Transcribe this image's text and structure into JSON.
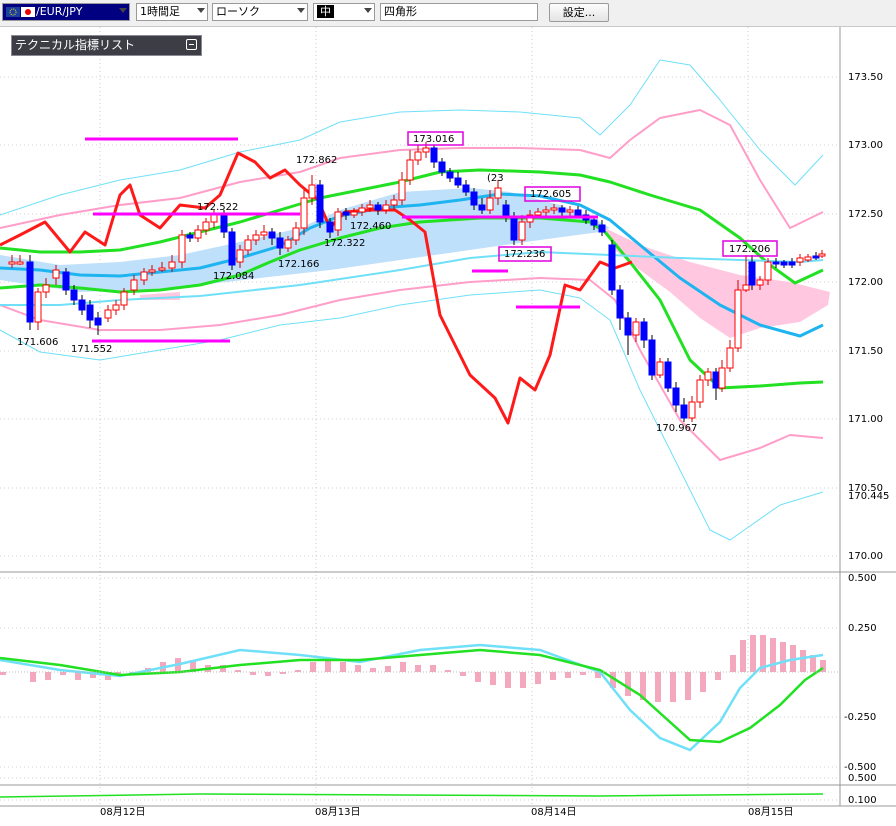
{
  "toolbar": {
    "symbol": "/EUR/JPY",
    "timeframe": "1時間足",
    "chart_type": "ローソク",
    "line_style": "中",
    "drawing_tool": "四角形",
    "settings_label": "設定..."
  },
  "indicator_panel": {
    "title": "テクニカル指標リスト"
  },
  "price_axis": {
    "labels": [
      "173.50",
      "173.00",
      "172.50",
      "172.00",
      "171.50",
      "171.00",
      "170.50",
      "170.00"
    ],
    "current_price": "170.445"
  },
  "macd_axis": {
    "labels": [
      "0.500",
      "0.250",
      "-0.250",
      "-0.500"
    ]
  },
  "sub_axis": {
    "labels": [
      "0.500",
      "0.100"
    ]
  },
  "time_axis": {
    "labels": [
      "08月12日",
      "08月13日",
      "08月14日",
      "08月15日"
    ]
  },
  "annotations": {
    "high_1": "172.862",
    "high_2": "172.522",
    "low_1": "172.084",
    "low_2": "172.166",
    "low_3": "172.322",
    "mid_1": "172.460",
    "low_left_1": "171.606",
    "low_left_2": "171.552",
    "box_high": "173.016",
    "box_mid_high": "172.605",
    "box_mid_low": "172.236",
    "small_label": "(23",
    "box_right": "172.206",
    "low_main": "170.967"
  },
  "colors": {
    "bull": "#ff0000",
    "bear": "#0000ff",
    "ma_red": "#ff1a1a",
    "ma_green": "#22e022",
    "ma_blue": "#1eb4f0",
    "band_pink": "#ff9ec8",
    "band_cyan": "#6fe0f8",
    "cloud_blue": "#bfe0fa",
    "cloud_pink": "#ffc8e0",
    "marker": "#ff00ff"
  }
}
